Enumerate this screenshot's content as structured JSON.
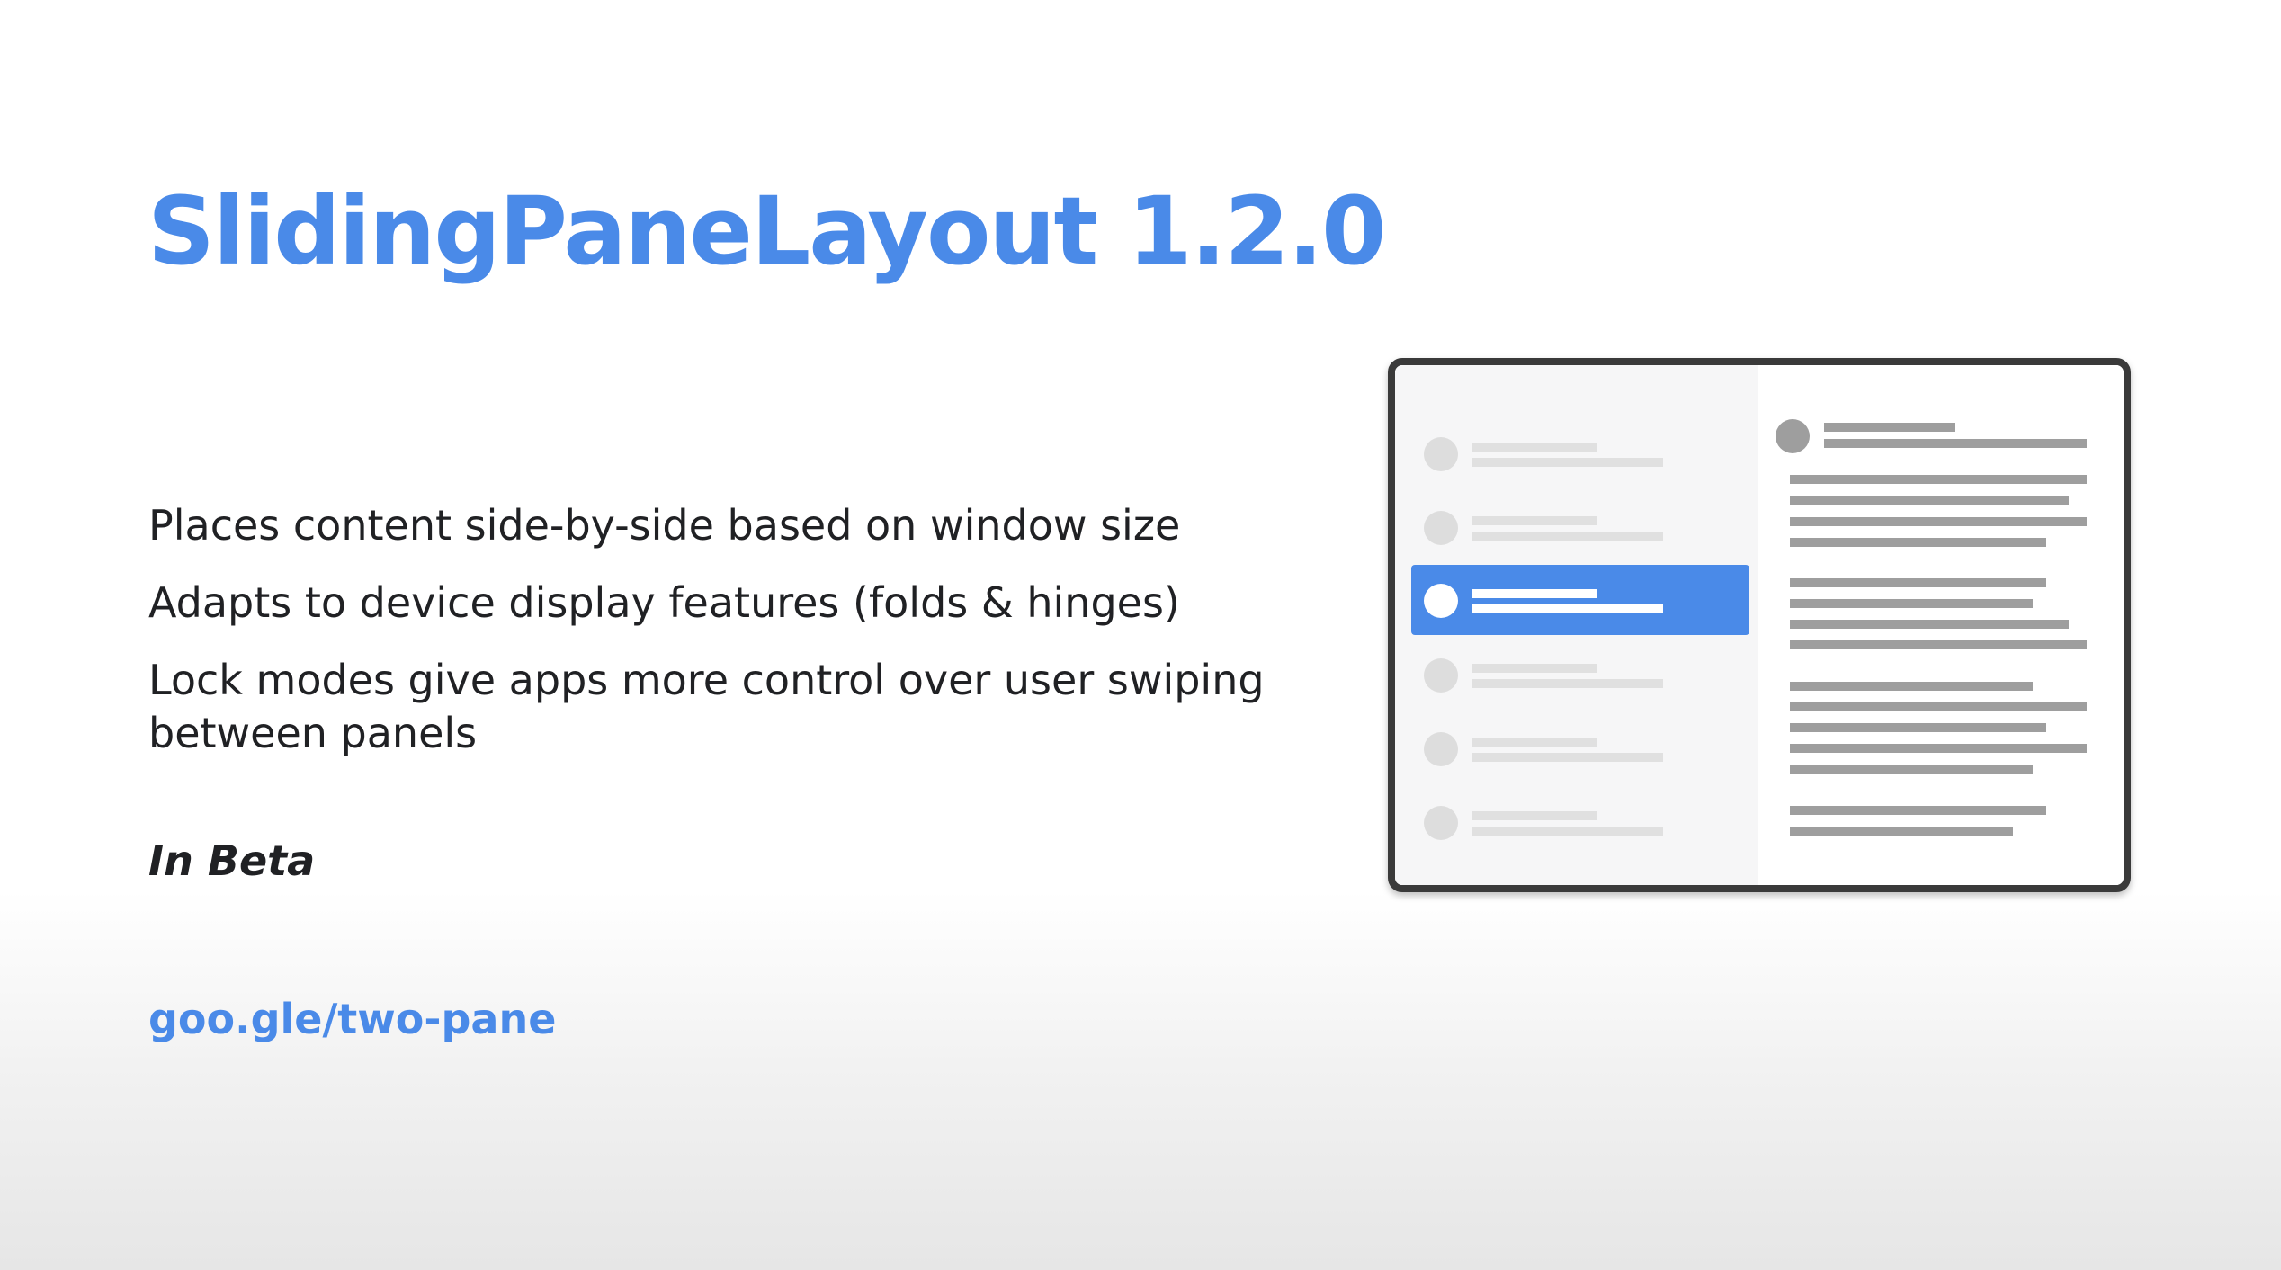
{
  "slide": {
    "title": "SlidingPaneLayout 1.2.0",
    "bullets": [
      "Places content side-by-side based on window size",
      "Adapts to device display features (folds & hinges)",
      "Lock modes give apps more control over user swiping between panels"
    ],
    "status": "In Beta",
    "link": "goo.gle/two-pane"
  },
  "colors": {
    "accent": "#4a8ae8",
    "body_text": "#202124",
    "device_frame": "#3a3a3a",
    "list_pane_bg": "#f6f6f7",
    "placeholder_light": "#e0e0e0",
    "placeholder_dark": "#9e9e9e"
  },
  "illustration": {
    "list_item_count": 6,
    "selected_item": 3
  }
}
